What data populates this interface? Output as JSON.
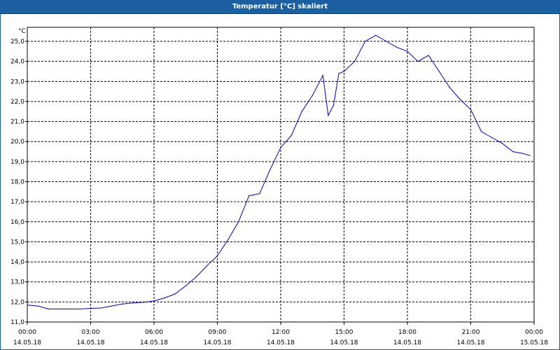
{
  "window": {
    "title": "Temperatur [°C] skaliert"
  },
  "chart_data": {
    "type": "line",
    "title": "Temperatur [°C] skaliert",
    "y_unit": "°C",
    "xlabel": "",
    "ylabel": "°C",
    "ylim": [
      11.0,
      25.7
    ],
    "y_ticks": [
      "11,0",
      "12,0",
      "13,0",
      "14,0",
      "15,0",
      "16,0",
      "17,0",
      "18,0",
      "19,0",
      "20,0",
      "21,0",
      "22,0",
      "23,0",
      "24,0",
      "25,0"
    ],
    "x_ticks": [
      {
        "time": "00:00",
        "date": "14.05.18"
      },
      {
        "time": "03:00",
        "date": "14.05.18"
      },
      {
        "time": "06:00",
        "date": "14.05.18"
      },
      {
        "time": "09:00",
        "date": "14.05.18"
      },
      {
        "time": "12:00",
        "date": "14.05.18"
      },
      {
        "time": "15:00",
        "date": "14.05.18"
      },
      {
        "time": "18:00",
        "date": "14.05.18"
      },
      {
        "time": "21:00",
        "date": "14.05.18"
      },
      {
        "time": "00:00",
        "date": "15.05.18"
      }
    ],
    "grid": true,
    "series_color": "#0000c8",
    "x_hours": [
      0,
      0.5,
      1,
      1.5,
      2,
      2.5,
      3,
      3.5,
      4,
      4.5,
      5,
      5.5,
      6,
      6.5,
      7,
      7.5,
      8,
      8.5,
      9,
      9.5,
      10,
      10.5,
      11,
      11.5,
      12,
      12.5,
      13,
      13.5,
      14,
      14.25,
      14.5,
      14.75,
      15,
      15.5,
      16,
      16.5,
      17,
      17.5,
      18,
      18.5,
      19,
      19.5,
      20,
      20.5,
      21,
      21.5,
      22,
      22.5,
      23,
      23.5,
      23.8
    ],
    "y_values": [
      11.85,
      11.8,
      11.65,
      11.65,
      11.65,
      11.65,
      11.68,
      11.7,
      11.8,
      11.9,
      11.95,
      11.98,
      12.05,
      12.2,
      12.4,
      12.8,
      13.25,
      13.8,
      14.3,
      15.1,
      16.0,
      17.3,
      17.4,
      18.6,
      19.7,
      20.3,
      21.5,
      22.3,
      23.3,
      21.3,
      21.8,
      23.4,
      23.5,
      24.0,
      25.0,
      25.3,
      25.0,
      24.7,
      24.5,
      24.0,
      24.3,
      23.5,
      22.7,
      22.1,
      21.6,
      20.5,
      20.2,
      19.9,
      19.5,
      19.4,
      19.3
    ]
  }
}
